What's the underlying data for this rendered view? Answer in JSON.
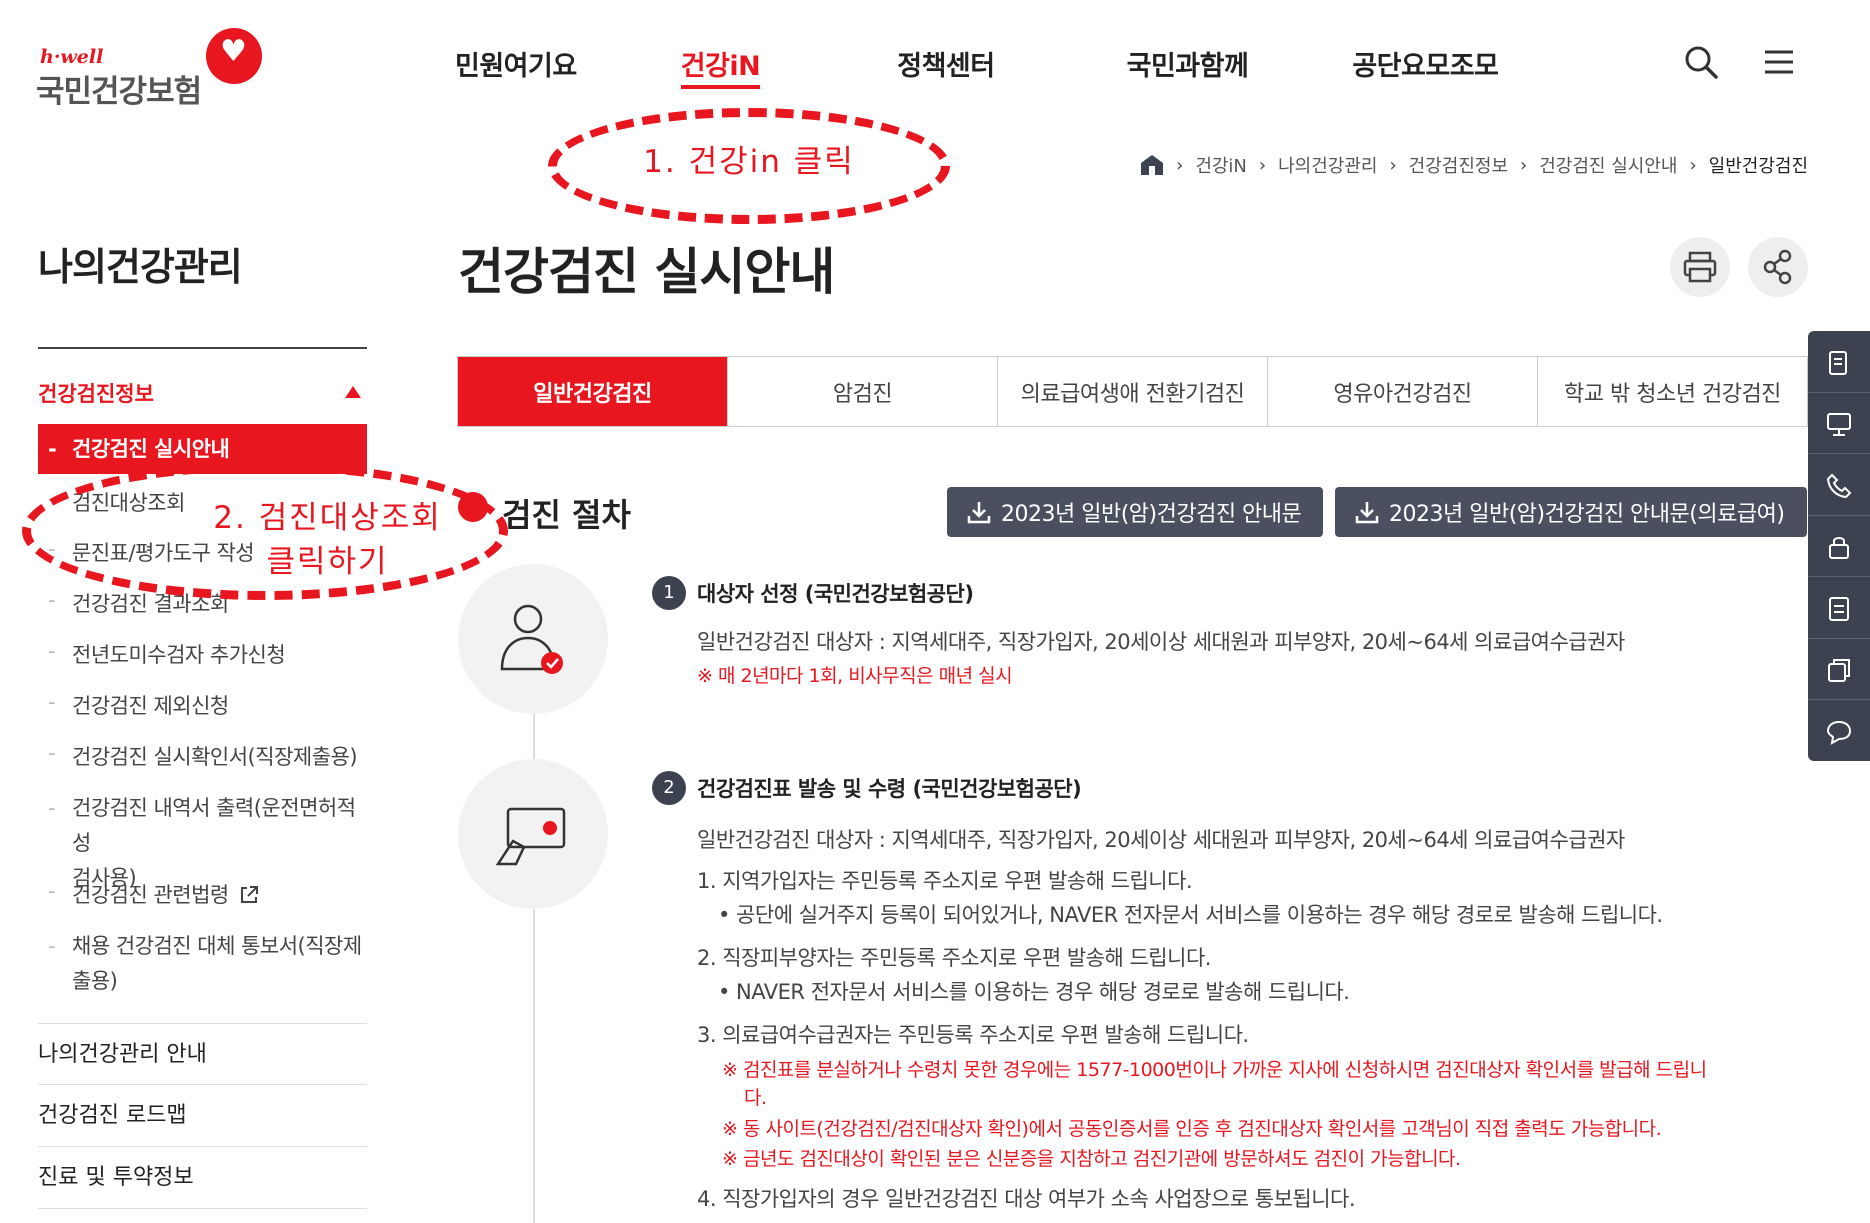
{
  "header": {
    "logo": {
      "tag": "h·well",
      "name": "국민건강보험"
    },
    "nav": [
      "민원여기요",
      "건강iN",
      "정책센터",
      "국민과함께",
      "공단요모조모"
    ],
    "active_nav": "건강iN",
    "icons": [
      "search-icon",
      "menu-icon"
    ]
  },
  "breadcrumb": [
    "건강iN",
    "나의건강관리",
    "건강검진정보",
    "건강검진 실시안내",
    "일반건강검진"
  ],
  "sidebar": {
    "title": "나의건강관리",
    "group": "건강검진정보",
    "sub_items": [
      {
        "label": "건강검진 실시안내",
        "active": true
      },
      {
        "label": "검진대상조회"
      },
      {
        "label": "문진표/평가도구 작성"
      },
      {
        "label": "건강검진 결과조회"
      },
      {
        "label": "전년도미수검자 추가신청"
      },
      {
        "label": "건강검진 제외신청"
      },
      {
        "label": "건강검진 실시확인서(직장제출용)"
      },
      {
        "label": "건강검진 내역서 출력(운전면허적성",
        "label2": "검사용)"
      },
      {
        "label": "건강검진 관련법령"
      },
      {
        "label": "채용 건강검진 대체 통보서(직장제",
        "label2": "출용)"
      }
    ],
    "menus": [
      "나의건강관리 안내",
      "건강검진 로드맵",
      "진료 및 투약정보"
    ]
  },
  "main": {
    "title": "건강검진 실시안내",
    "tabs": [
      "일반건강검진",
      "암검진",
      "의료급여생애 전환기검진",
      "영유아건강검진",
      "학교 밖 청소년 건강검진"
    ],
    "section_title": "검진 절차",
    "downloads": [
      "2023년 일반(암)건강검진 안내문",
      "2023년 일반(암)건강검진 안내문(의료급여)"
    ],
    "steps": [
      {
        "num": "1",
        "head": "대상자 선정 (국민건강보험공단)",
        "line1": "일반건강검진 대상자 : 지역세대주, 직장가입자, 20세이상 세대원과 피부양자, 20세~64세 의료급여수급권자",
        "note": "※ 매 2년마다 1회, 비사무직은 매년 실시"
      },
      {
        "num": "2",
        "head": "건강검진표 발송 및 수령 (국민건강보험공단)",
        "line1": "일반건강검진 대상자 : 지역세대주, 직장가입자, 20세이상 세대원과 피부양자, 20세~64세 의료급여수급권자",
        "item1": "1. 지역가입자는 주민등록 주소지로 우편 발송해 드립니다.",
        "item1b": "• 공단에 실거주지 등록이 되어있거나, NAVER 전자문서 서비스를 이용하는 경우 해당 경로로 발송해 드립니다.",
        "item2": "2. 직장피부양자는 주민등록 주소지로 우편 발송해 드립니다.",
        "item2b": "• NAVER 전자문서 서비스를 이용하는 경우 해당 경로로 발송해 드립니다.",
        "item3": "3. 의료급여수급권자는 주민등록 주소지로 우편 발송해 드립니다.",
        "note1": "※ 검진표를 분실하거나 수령치 못한 경우에는 1577-1000번이나 가까운 지사에 신청하시면 검진대상자 확인서를 발급해 드립니",
        "note1b": "다.",
        "note2": "※ 동 사이트(건강검진/검진대상자 확인)에서 공동인증서를 인증 후 검진대상자 확인서를 고객님이 직접 출력도 가능합니다.",
        "note3": "※ 금년도 검진대상이 확인된 분은 신분증을 지참하고 검진기관에 방문하셔도 검진이 가능합니다.",
        "item4": "4. 직장가입자의 경우 일반건강검진 대상 여부가 소속 사업장으로 통보됩니다."
      }
    ]
  },
  "annotations": {
    "a1": "1. 건강in 클릭",
    "a2_line1": "2. 검진대상조회",
    "a2_line2": "클릭하기"
  },
  "colors": {
    "brand_red": "#e8161f",
    "dark_button": "#4a5060"
  }
}
